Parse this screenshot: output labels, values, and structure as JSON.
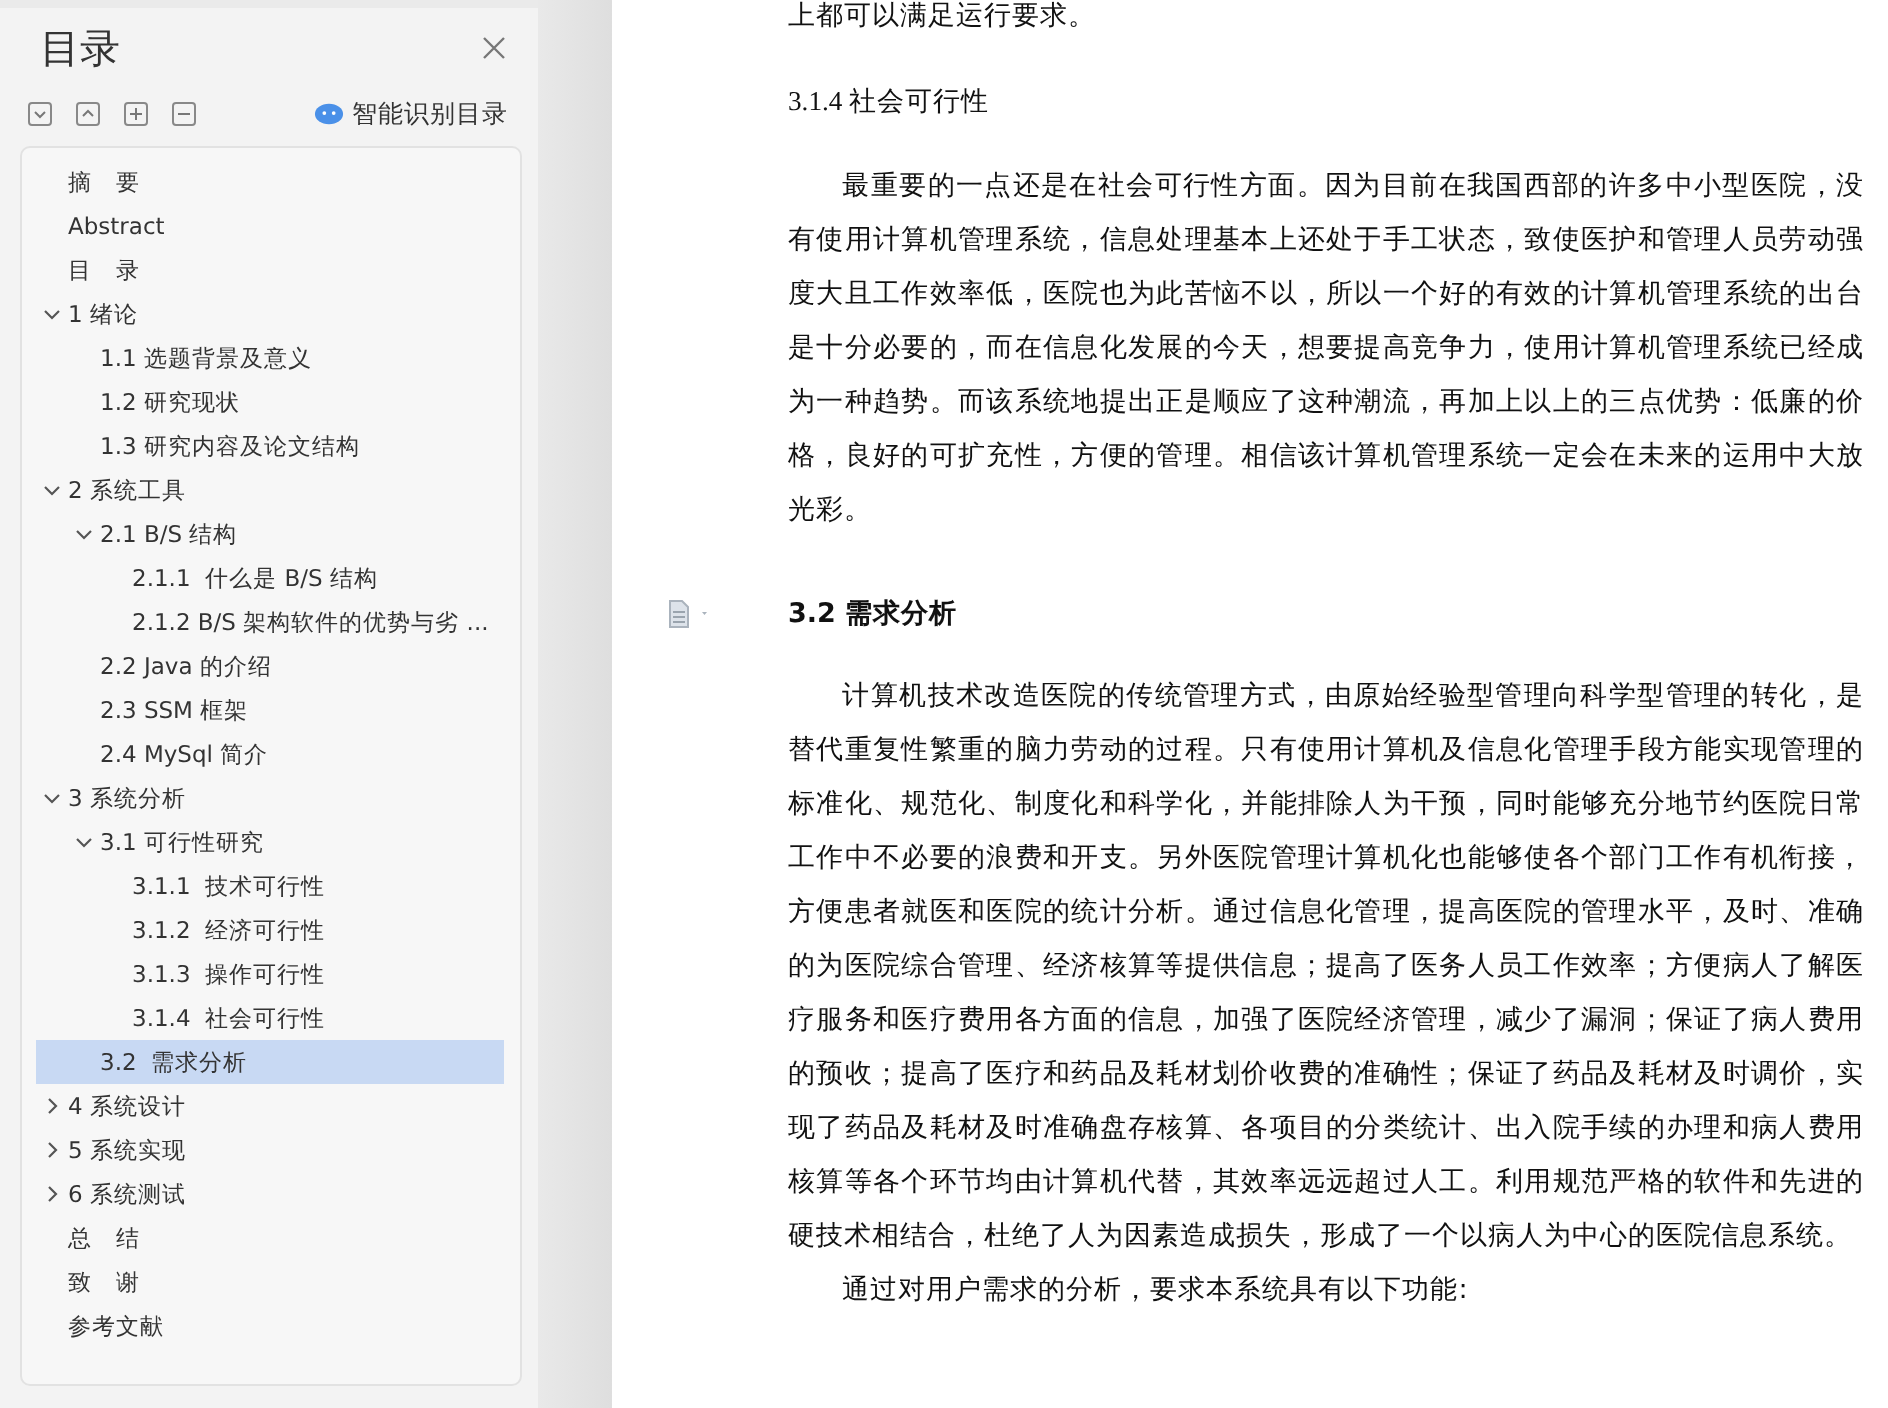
{
  "sidebar": {
    "title": "目录",
    "smart_button": "智能识别目录",
    "toc": [
      {
        "label": "摘　要",
        "selected": false
      },
      {
        "label": "Abstract",
        "selected": false
      },
      {
        "label": "目　录",
        "selected": false
      },
      {
        "label": "1 绪论",
        "selected": false,
        "expanded": true,
        "children": [
          {
            "label": "1.1 选题背景及意义",
            "selected": false
          },
          {
            "label": "1.2 研究现状",
            "selected": false
          },
          {
            "label": "1.3 研究内容及论文结构",
            "selected": false
          }
        ]
      },
      {
        "label": "2 系统工具",
        "selected": false,
        "expanded": true,
        "children": [
          {
            "label": "2.1 B/S 结构",
            "selected": false,
            "expanded": true,
            "children": [
              {
                "label": "2.1.1  什么是 B/S 结构",
                "selected": false
              },
              {
                "label": "2.1.2 B/S 架构软件的优势与劣 ...",
                "selected": false
              }
            ]
          },
          {
            "label": "2.2 Java 的介绍",
            "selected": false
          },
          {
            "label": "2.3 SSM 框架",
            "selected": false
          },
          {
            "label": "2.4 MySql 简介",
            "selected": false
          }
        ]
      },
      {
        "label": "3 系统分析",
        "selected": false,
        "expanded": true,
        "children": [
          {
            "label": "3.1 可行性研究",
            "selected": false,
            "expanded": true,
            "children": [
              {
                "label": "3.1.1  技术可行性",
                "selected": false
              },
              {
                "label": "3.1.2  经济可行性",
                "selected": false
              },
              {
                "label": "3.1.3  操作可行性",
                "selected": false
              },
              {
                "label": "3.1.4  社会可行性",
                "selected": false
              }
            ]
          },
          {
            "label": "3.2  需求分析",
            "selected": true
          }
        ]
      },
      {
        "label": "4 系统设计",
        "selected": false,
        "expanded": false
      },
      {
        "label": "5 系统实现",
        "selected": false,
        "expanded": false
      },
      {
        "label": "6 系统测试",
        "selected": false,
        "expanded": false
      },
      {
        "label": "总　结",
        "selected": false
      },
      {
        "label": "致　谢",
        "selected": false
      },
      {
        "label": "参考文献",
        "selected": false
      }
    ]
  },
  "document": {
    "blocks": [
      {
        "kind": "continuation",
        "text": "上都可以满足运行要求。"
      },
      {
        "kind": "subheading",
        "text": "3.1.4  社会可行性"
      },
      {
        "kind": "paragraph",
        "text": "最重要的一点还是在社会可行性方面。因为目前在我国西部的许多中小型医院，没有使用计算机管理系统，信息处理基本上还处于手工状态，致使医护和管理人员劳动强度大且工作效率低，医院也为此苦恼不以，所以一个好的有效的计算机管理系统的出台是十分必要的，而在信息化发展的今天，想要提高竞争力，使用计算机管理系统已经成为一种趋势。而该系统地提出正是顺应了这种潮流，再加上以上的三点优势：低廉的价格，良好的可扩充性，方便的管理。相信该计算机管理系统一定会在未来的运用中大放光彩。"
      },
      {
        "kind": "heading",
        "text": "3.2  需求分析"
      },
      {
        "kind": "paragraph",
        "text": "计算机技术改造医院的传统管理方式，由原始经验型管理向科学型管理的转化，是替代重复性繁重的脑力劳动的过程。只有使用计算机及信息化管理手段方能实现管理的标准化、规范化、制度化和科学化，并能排除人为干预，同时能够充分地节约医院日常工作中不必要的浪费和开支。另外医院管理计算机化也能够使各个部门工作有机衔接，方便患者就医和医院的统计分析。通过信息化管理，提高医院的管理水平，及时、准确的为医院综合管理、经济核算等提供信息；提高了医务人员工作效率；方便病人了解医疗服务和医疗费用各方面的信息，加强了医院经济管理，减少了漏洞；保证了病人费用的预收；提高了医疗和药品及耗材划价收费的准确性；保证了药品及耗材及时调价，实现了药品及耗材及时准确盘存核算、各项目的分类统计、出入院手续的办理和病人费用核算等各个环节均由计算机代替，其效率远远超过人工。利用规范严格的软件和先进的硬技术相结合，杜绝了人为因素造成损失，形成了一个以病人为中心的医院信息系统。"
      },
      {
        "kind": "paragraph",
        "text": "通过对用户需求的分析，要求本系统具有以下功能:"
      }
    ]
  }
}
